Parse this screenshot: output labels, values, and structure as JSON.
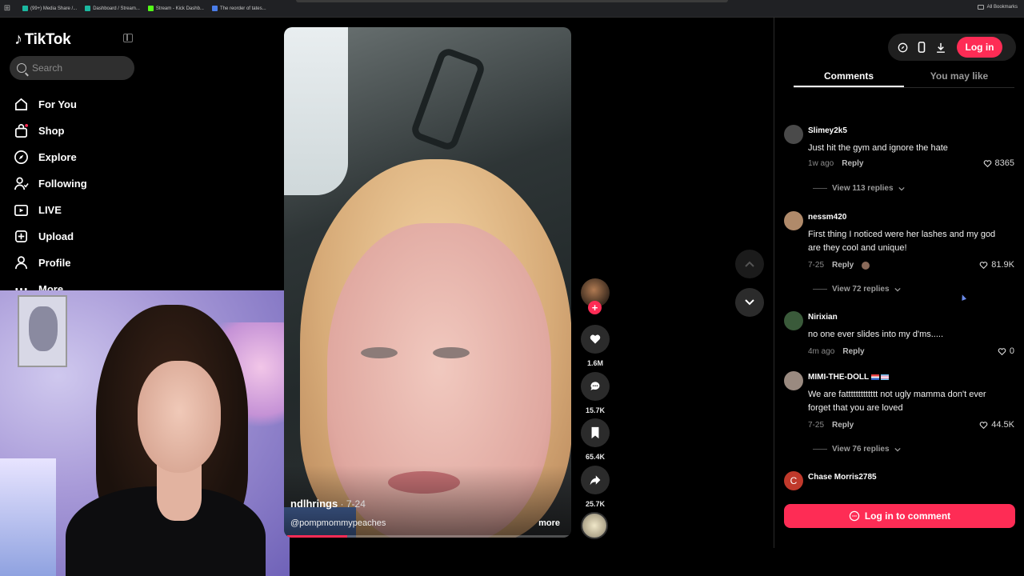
{
  "browser": {
    "bookmarks": [
      {
        "label": "(99+) Media Share /...",
        "color": "#1bb8a0"
      },
      {
        "label": "Dashboard / Stream...",
        "color": "#1bb8a0"
      },
      {
        "label": "Stream - Kick Dashb...",
        "color": "#53fc18"
      },
      {
        "label": "The reorder of tates...",
        "color": "#4a7de8"
      }
    ],
    "all_bookmarks": "All Bookmarks"
  },
  "sidebar": {
    "logo": "TikTok",
    "search_placeholder": "Search",
    "items": [
      {
        "label": "For You",
        "icon": "home-icon"
      },
      {
        "label": "Shop",
        "icon": "shopping-bag-icon"
      },
      {
        "label": "Explore",
        "icon": "compass-icon"
      },
      {
        "label": "Following",
        "icon": "following-icon"
      },
      {
        "label": "LIVE",
        "icon": "live-icon"
      },
      {
        "label": "Upload",
        "icon": "upload-icon"
      },
      {
        "label": "Profile",
        "icon": "profile-icon"
      },
      {
        "label": "More",
        "icon": "more-icon"
      }
    ]
  },
  "video": {
    "username": "ndlhrings",
    "date": " · 7-24",
    "mention": "@pompmommypeaches",
    "more_label": "more",
    "progress": 0.21
  },
  "actions": {
    "likes": "1.6M",
    "comments": "15.7K",
    "saves": "65.4K",
    "shares": "25.7K"
  },
  "right_panel": {
    "login_label": "Log in",
    "tabs": [
      "Comments",
      "You may like"
    ],
    "comments": [
      {
        "user": "Slimey2k5",
        "text": "Just hit the gym and ignore the hate",
        "age": "1w ago",
        "reply": "Reply",
        "likes": "8365",
        "view_replies": "View 113 replies",
        "avatar_color": "#4a4a4a"
      },
      {
        "user": "nessm420",
        "text": "First thing I noticed were her lashes and my god are they cool and unique!",
        "age": "7-25",
        "reply": "Reply",
        "likes": "81.9K",
        "view_replies": "View 72 replies",
        "avatar_color": "#b08a6a"
      },
      {
        "user": "Nirixian",
        "text": "no one ever slides into my d'ms.....",
        "age": "4m ago",
        "reply": "Reply",
        "likes": "0",
        "view_replies": "",
        "avatar_color": "#3a5a3a"
      },
      {
        "user": "MIMI-THE-DOLL",
        "text": "We are fattttttttttttt not ugly mamma don't ever forget that you are loved",
        "age": "7-25",
        "reply": "Reply",
        "likes": "44.5K",
        "view_replies": "View 76 replies",
        "avatar_color": "#9a8a80"
      },
      {
        "user": "Chase Morris2785",
        "text": "",
        "age": "",
        "reply": "",
        "likes": "",
        "view_replies": "",
        "avatar_color": "#c0392b",
        "avatar_letter": "C"
      }
    ],
    "login_to_comment": "Log in to comment"
  },
  "colors": {
    "accent": "#fe2c55",
    "background": "#000000",
    "surface": "#2b2b2b"
  }
}
